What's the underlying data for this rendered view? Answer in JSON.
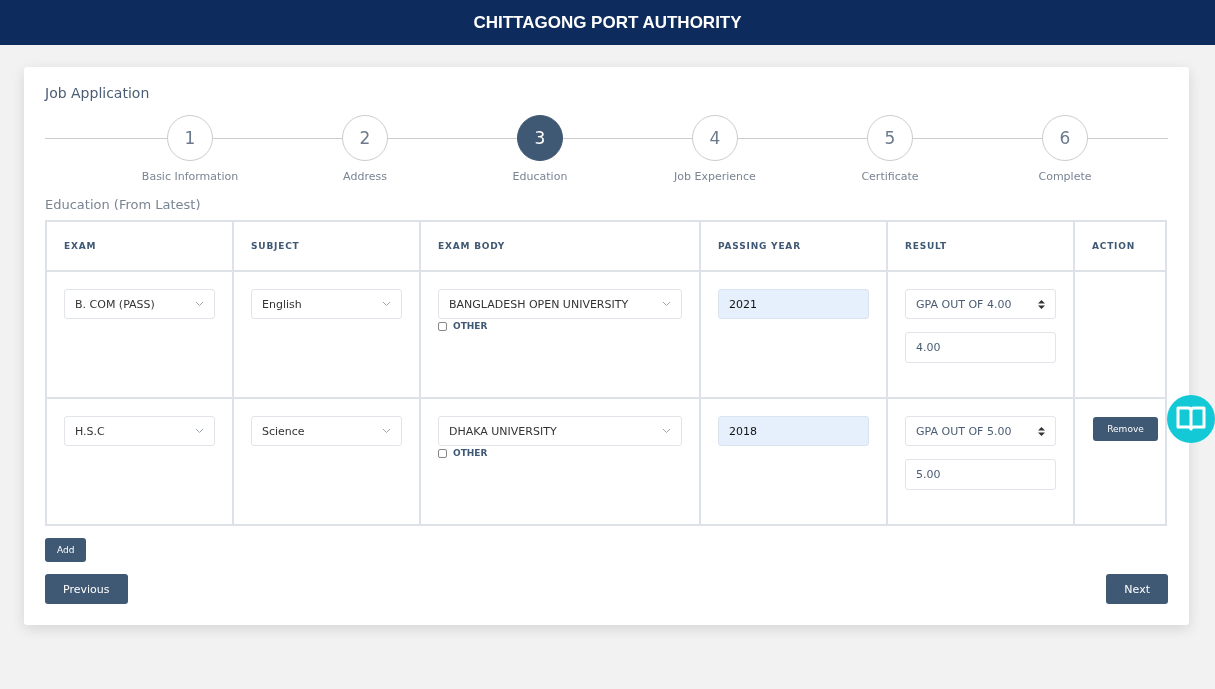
{
  "header": {
    "title": "CHITTAGONG PORT AUTHORITY"
  },
  "card": {
    "title": "Job Application"
  },
  "steps": [
    {
      "number": "1",
      "label": "Basic Information",
      "selected": false
    },
    {
      "number": "2",
      "label": "Address",
      "selected": false
    },
    {
      "number": "3",
      "label": "Education",
      "selected": true
    },
    {
      "number": "4",
      "label": "Job Experience",
      "selected": false
    },
    {
      "number": "5",
      "label": "Certificate",
      "selected": false
    },
    {
      "number": "6",
      "label": "Complete",
      "selected": false
    }
  ],
  "section_title": "Education (From Latest)",
  "table": {
    "columns": [
      "EXAM",
      "SUBJECT",
      "EXAM BODY",
      "PASSING YEAR",
      "RESULT",
      "ACTION"
    ],
    "rows": [
      {
        "exam": "B. COM (PASS)",
        "subject": "English",
        "exam_body": "BANGLADESH OPEN UNIVERSITY",
        "other_label": "OTHER",
        "other_checked": false,
        "passing_year": "2021",
        "result_scale": "GPA OUT OF 4.00",
        "result": "4.00"
      },
      {
        "exam": "H.S.C",
        "subject": "Science",
        "exam_body": "DHAKA UNIVERSITY",
        "other_label": "OTHER",
        "other_checked": false,
        "passing_year": "2018",
        "result_scale": "GPA OUT OF 5.00",
        "result": "5.00",
        "action": "Remove"
      }
    ]
  },
  "add_button": "Add",
  "previous_button": "Previous",
  "next_button": "Next"
}
